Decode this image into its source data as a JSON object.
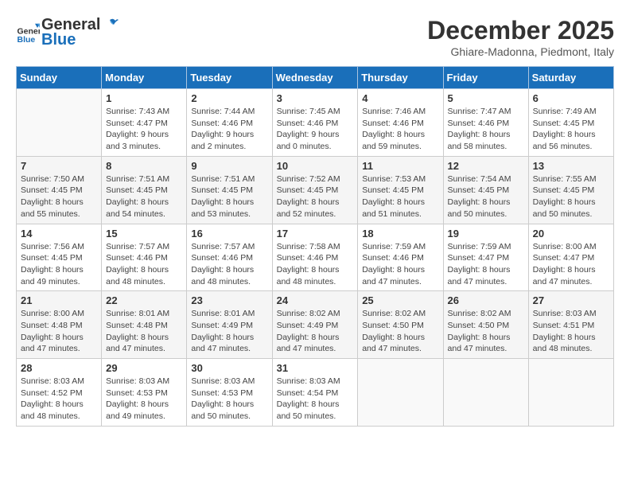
{
  "header": {
    "logo_general": "General",
    "logo_blue": "Blue",
    "month": "December 2025",
    "location": "Ghiare-Madonna, Piedmont, Italy"
  },
  "weekdays": [
    "Sunday",
    "Monday",
    "Tuesday",
    "Wednesday",
    "Thursday",
    "Friday",
    "Saturday"
  ],
  "weeks": [
    [
      {
        "day": "",
        "info": ""
      },
      {
        "day": "1",
        "info": "Sunrise: 7:43 AM\nSunset: 4:47 PM\nDaylight: 9 hours\nand 3 minutes."
      },
      {
        "day": "2",
        "info": "Sunrise: 7:44 AM\nSunset: 4:46 PM\nDaylight: 9 hours\nand 2 minutes."
      },
      {
        "day": "3",
        "info": "Sunrise: 7:45 AM\nSunset: 4:46 PM\nDaylight: 9 hours\nand 0 minutes."
      },
      {
        "day": "4",
        "info": "Sunrise: 7:46 AM\nSunset: 4:46 PM\nDaylight: 8 hours\nand 59 minutes."
      },
      {
        "day": "5",
        "info": "Sunrise: 7:47 AM\nSunset: 4:46 PM\nDaylight: 8 hours\nand 58 minutes."
      },
      {
        "day": "6",
        "info": "Sunrise: 7:49 AM\nSunset: 4:45 PM\nDaylight: 8 hours\nand 56 minutes."
      }
    ],
    [
      {
        "day": "7",
        "info": "Sunrise: 7:50 AM\nSunset: 4:45 PM\nDaylight: 8 hours\nand 55 minutes."
      },
      {
        "day": "8",
        "info": "Sunrise: 7:51 AM\nSunset: 4:45 PM\nDaylight: 8 hours\nand 54 minutes."
      },
      {
        "day": "9",
        "info": "Sunrise: 7:51 AM\nSunset: 4:45 PM\nDaylight: 8 hours\nand 53 minutes."
      },
      {
        "day": "10",
        "info": "Sunrise: 7:52 AM\nSunset: 4:45 PM\nDaylight: 8 hours\nand 52 minutes."
      },
      {
        "day": "11",
        "info": "Sunrise: 7:53 AM\nSunset: 4:45 PM\nDaylight: 8 hours\nand 51 minutes."
      },
      {
        "day": "12",
        "info": "Sunrise: 7:54 AM\nSunset: 4:45 PM\nDaylight: 8 hours\nand 50 minutes."
      },
      {
        "day": "13",
        "info": "Sunrise: 7:55 AM\nSunset: 4:45 PM\nDaylight: 8 hours\nand 50 minutes."
      }
    ],
    [
      {
        "day": "14",
        "info": "Sunrise: 7:56 AM\nSunset: 4:45 PM\nDaylight: 8 hours\nand 49 minutes."
      },
      {
        "day": "15",
        "info": "Sunrise: 7:57 AM\nSunset: 4:46 PM\nDaylight: 8 hours\nand 48 minutes."
      },
      {
        "day": "16",
        "info": "Sunrise: 7:57 AM\nSunset: 4:46 PM\nDaylight: 8 hours\nand 48 minutes."
      },
      {
        "day": "17",
        "info": "Sunrise: 7:58 AM\nSunset: 4:46 PM\nDaylight: 8 hours\nand 48 minutes."
      },
      {
        "day": "18",
        "info": "Sunrise: 7:59 AM\nSunset: 4:46 PM\nDaylight: 8 hours\nand 47 minutes."
      },
      {
        "day": "19",
        "info": "Sunrise: 7:59 AM\nSunset: 4:47 PM\nDaylight: 8 hours\nand 47 minutes."
      },
      {
        "day": "20",
        "info": "Sunrise: 8:00 AM\nSunset: 4:47 PM\nDaylight: 8 hours\nand 47 minutes."
      }
    ],
    [
      {
        "day": "21",
        "info": "Sunrise: 8:00 AM\nSunset: 4:48 PM\nDaylight: 8 hours\nand 47 minutes."
      },
      {
        "day": "22",
        "info": "Sunrise: 8:01 AM\nSunset: 4:48 PM\nDaylight: 8 hours\nand 47 minutes."
      },
      {
        "day": "23",
        "info": "Sunrise: 8:01 AM\nSunset: 4:49 PM\nDaylight: 8 hours\nand 47 minutes."
      },
      {
        "day": "24",
        "info": "Sunrise: 8:02 AM\nSunset: 4:49 PM\nDaylight: 8 hours\nand 47 minutes."
      },
      {
        "day": "25",
        "info": "Sunrise: 8:02 AM\nSunset: 4:50 PM\nDaylight: 8 hours\nand 47 minutes."
      },
      {
        "day": "26",
        "info": "Sunrise: 8:02 AM\nSunset: 4:50 PM\nDaylight: 8 hours\nand 47 minutes."
      },
      {
        "day": "27",
        "info": "Sunrise: 8:03 AM\nSunset: 4:51 PM\nDaylight: 8 hours\nand 48 minutes."
      }
    ],
    [
      {
        "day": "28",
        "info": "Sunrise: 8:03 AM\nSunset: 4:52 PM\nDaylight: 8 hours\nand 48 minutes."
      },
      {
        "day": "29",
        "info": "Sunrise: 8:03 AM\nSunset: 4:53 PM\nDaylight: 8 hours\nand 49 minutes."
      },
      {
        "day": "30",
        "info": "Sunrise: 8:03 AM\nSunset: 4:53 PM\nDaylight: 8 hours\nand 50 minutes."
      },
      {
        "day": "31",
        "info": "Sunrise: 8:03 AM\nSunset: 4:54 PM\nDaylight: 8 hours\nand 50 minutes."
      },
      {
        "day": "",
        "info": ""
      },
      {
        "day": "",
        "info": ""
      },
      {
        "day": "",
        "info": ""
      }
    ]
  ]
}
